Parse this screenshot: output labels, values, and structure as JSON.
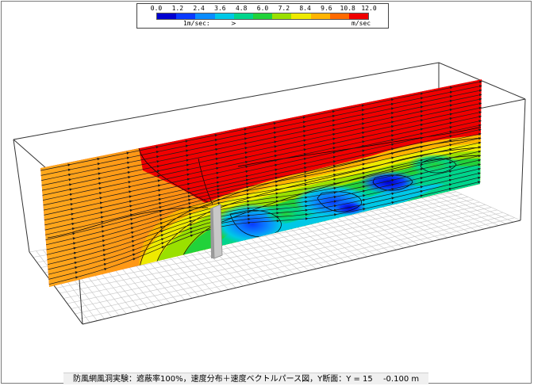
{
  "legend": {
    "ticks": [
      "0.0",
      "1.2",
      "2.4",
      "3.6",
      "4.8",
      "6.0",
      "7.2",
      "8.4",
      "9.6",
      "10.8",
      "12.0"
    ],
    "vector_label": "1m/sec:",
    "vector_arrow": ">",
    "unit_label": "m/sec",
    "colors": [
      "#0000d0",
      "#0a3aff",
      "#0a8cff",
      "#00c8e6",
      "#00d58c",
      "#22d23a",
      "#9ae000",
      "#eeea00",
      "#ffb400",
      "#ff6a00",
      "#f00000"
    ]
  },
  "caption": "防風網風洞実験：遮蔽率100%，速度分布＋速度ベクトルパース図，Y断面：Y = 15　 -0.100 m"
}
